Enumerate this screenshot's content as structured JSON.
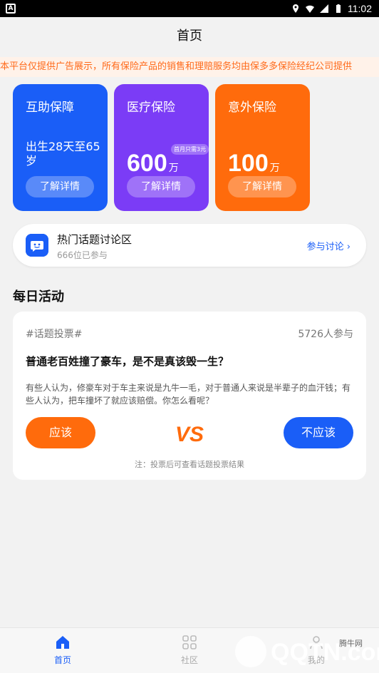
{
  "status_bar": {
    "time": "11:02"
  },
  "header": {
    "title": "首页"
  },
  "notice": {
    "text": "本平台仅提供广告展示，所有保险产品的销售和理赔服务均由保多多保险经纪公司提供"
  },
  "cards": [
    {
      "title": "互助保障",
      "desc": "出生28天至65岁",
      "button": "了解详情",
      "color": "#1a5ef7"
    },
    {
      "title": "医疗保险",
      "amount": "600",
      "unit": "万",
      "tag": "首月只需3元",
      "button": "了解详情",
      "color": "#7b3cf6"
    },
    {
      "title": "意外保险",
      "amount": "100",
      "unit": "万",
      "button": "了解详情",
      "color": "#ff6b0c"
    }
  ],
  "discussion": {
    "title": "热门话题讨论区",
    "participants": "666位已参与",
    "link": "参与讨论"
  },
  "daily": {
    "section_title": "每日活动",
    "topic": "#话题投票#",
    "count": "5726人参与",
    "question": "普通老百姓撞了豪车，是不是真该毁一生？",
    "description": "有些人认为，修豪车对于车主来说是九牛一毛，对于普通人来说是半辈子的血汗钱；有些人认为，把车撞坏了就应该赔偿。你怎么看呢？",
    "yes_label": "应该",
    "no_label": "不应该",
    "vs_label": "VS",
    "note": "注：投票后可查看话题投票结果"
  },
  "bottom_nav": [
    {
      "label": "首页",
      "icon": "home-icon",
      "active": true
    },
    {
      "label": "社区",
      "icon": "grid-icon",
      "active": false
    },
    {
      "label": "我的",
      "icon": "user-icon",
      "active": false
    }
  ],
  "watermark": {
    "text": "QQTN.com",
    "sub": "腾牛网"
  },
  "colors": {
    "primary": "#1a5ef7",
    "purple": "#7b3cf6",
    "orange": "#ff6b0c",
    "notice_text": "#ff6a1a"
  }
}
